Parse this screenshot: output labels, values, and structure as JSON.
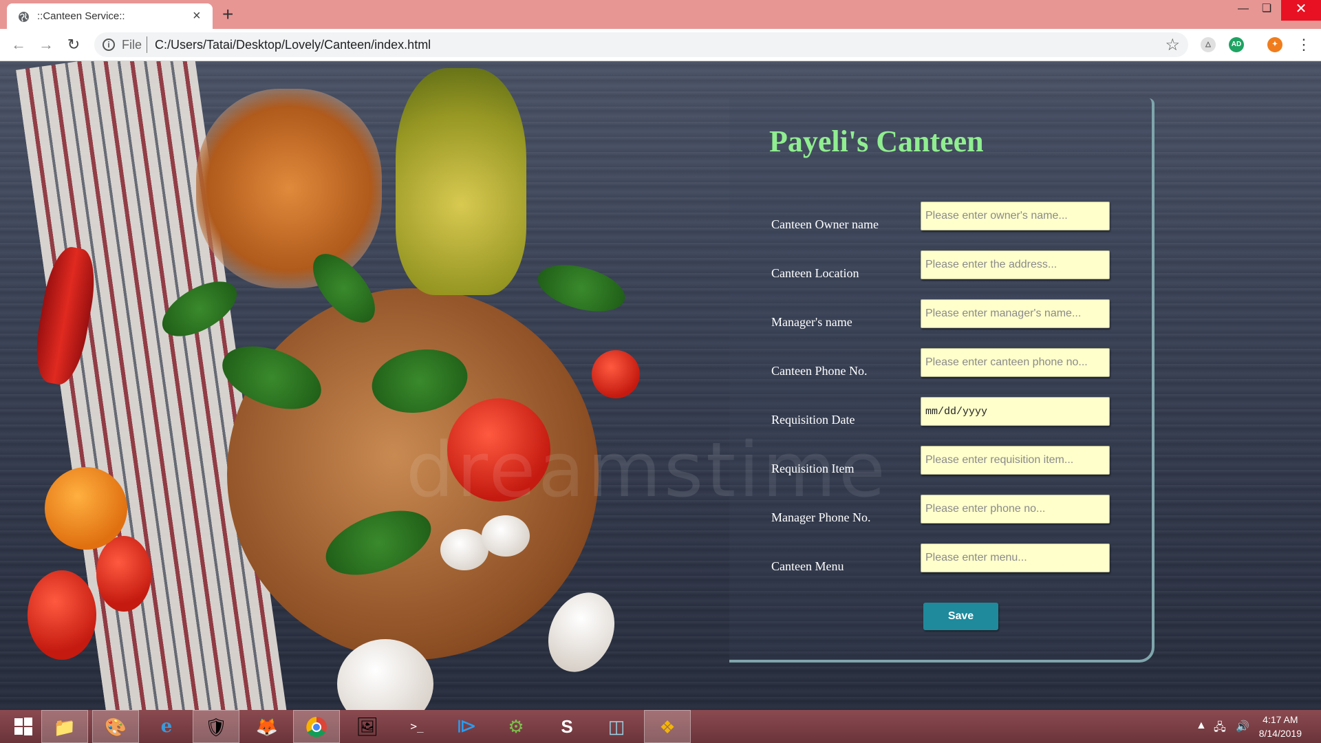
{
  "browser": {
    "tab_title": "::Canteen Service::",
    "close_tab_glyph": "×",
    "new_tab_glyph": "+",
    "file_label": "File",
    "url": "C:/Users/Tatai/Desktop/Lovely/Canteen/index.html",
    "extensions": [
      "AD"
    ]
  },
  "form": {
    "title": "Payeli's Canteen",
    "fields": [
      {
        "label": "Canteen Owner name",
        "placeholder": "Please enter owner's name..."
      },
      {
        "label": "Canteen Location",
        "placeholder": "Please enter the address..."
      },
      {
        "label": "Manager's name",
        "placeholder": "Please enter manager's name..."
      },
      {
        "label": "Canteen Phone No.",
        "placeholder": "Please enter canteen phone no..."
      },
      {
        "label": "Requisition Date",
        "value": "mm/dd/yyyy"
      },
      {
        "label": "Requisition Item",
        "placeholder": "Please enter requisition item..."
      },
      {
        "label": "Manager Phone No.",
        "placeholder": "Please enter phone no..."
      },
      {
        "label": "Canteen Menu",
        "placeholder": "Please enter menu..."
      }
    ],
    "save_label": "Save"
  },
  "taskbar": {
    "time": "4:17 AM",
    "date": "8/14/2019"
  },
  "colors": {
    "brand_title": "#90ee90",
    "input_bg": "#ffffcc",
    "save_button": "#1e8a9c",
    "tab_strip": "#e79694"
  }
}
